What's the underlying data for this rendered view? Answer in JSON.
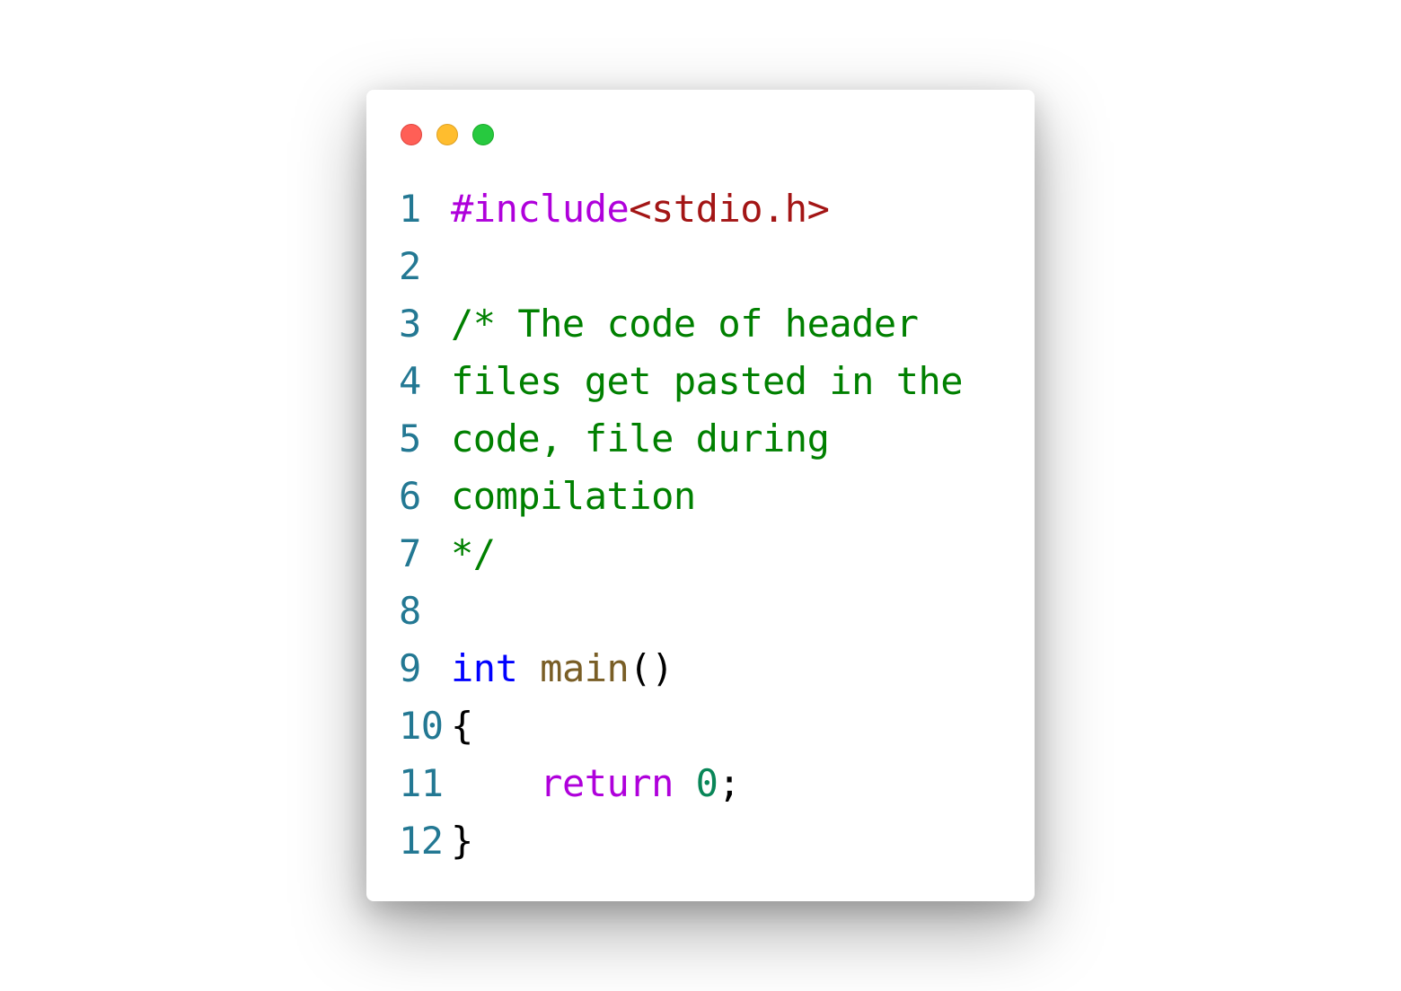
{
  "window": {
    "controls": [
      {
        "name": "close",
        "color": "#ff5f56",
        "border": "#e0443e"
      },
      {
        "name": "minimize",
        "color": "#ffbd2e",
        "border": "#dea123"
      },
      {
        "name": "maximize",
        "color": "#27c93f",
        "border": "#1aab29"
      }
    ]
  },
  "colors": {
    "line_number": "#237893",
    "preprocessor": "#af00db",
    "string": "#a31515",
    "comment": "#008000",
    "keyword": "#0000ff",
    "function": "#795e26",
    "control": "#af00db",
    "number": "#098658",
    "plain": "#000000"
  },
  "code": {
    "lines": [
      {
        "number": "1",
        "tokens": [
          {
            "text": "#include",
            "type": "preprocessor"
          },
          {
            "text": "<stdio.h>",
            "type": "string"
          }
        ]
      },
      {
        "number": "2",
        "tokens": []
      },
      {
        "number": "3",
        "tokens": [
          {
            "text": "/* The code of header",
            "type": "comment"
          }
        ]
      },
      {
        "number": "4",
        "tokens": [
          {
            "text": "files get pasted in the",
            "type": "comment"
          }
        ]
      },
      {
        "number": "5",
        "tokens": [
          {
            "text": "code, file during",
            "type": "comment"
          }
        ]
      },
      {
        "number": "6",
        "tokens": [
          {
            "text": "compilation",
            "type": "comment"
          }
        ]
      },
      {
        "number": "7",
        "tokens": [
          {
            "text": "*/",
            "type": "comment"
          }
        ]
      },
      {
        "number": "8",
        "tokens": []
      },
      {
        "number": "9",
        "tokens": [
          {
            "text": "int",
            "type": "keyword"
          },
          {
            "text": " ",
            "type": "plain"
          },
          {
            "text": "main",
            "type": "function"
          },
          {
            "text": "()",
            "type": "plain"
          }
        ]
      },
      {
        "number": "10",
        "tokens": [
          {
            "text": "{",
            "type": "plain"
          }
        ]
      },
      {
        "number": "11",
        "tokens": [
          {
            "text": "    ",
            "type": "plain"
          },
          {
            "text": "return",
            "type": "control"
          },
          {
            "text": " ",
            "type": "plain"
          },
          {
            "text": "0",
            "type": "number"
          },
          {
            "text": ";",
            "type": "plain"
          }
        ]
      },
      {
        "number": "12",
        "tokens": [
          {
            "text": "}",
            "type": "plain"
          }
        ]
      }
    ]
  }
}
